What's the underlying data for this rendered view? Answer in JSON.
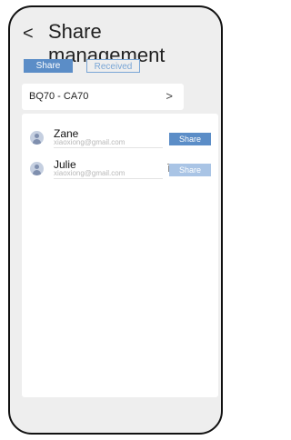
{
  "header": {
    "back_label": "<",
    "title": "Share management"
  },
  "tabs": [
    {
      "label": "Share"
    },
    {
      "label": "Received"
    }
  ],
  "device": {
    "name": "BQ70 - CA70",
    "chevron": ">"
  },
  "users": [
    {
      "name": "Zane",
      "email": "xiaoxiong@gmail.com",
      "action": "Share"
    },
    {
      "name": "Julie",
      "email": "xiaoxiong@gmail.com",
      "action": "Share"
    }
  ]
}
